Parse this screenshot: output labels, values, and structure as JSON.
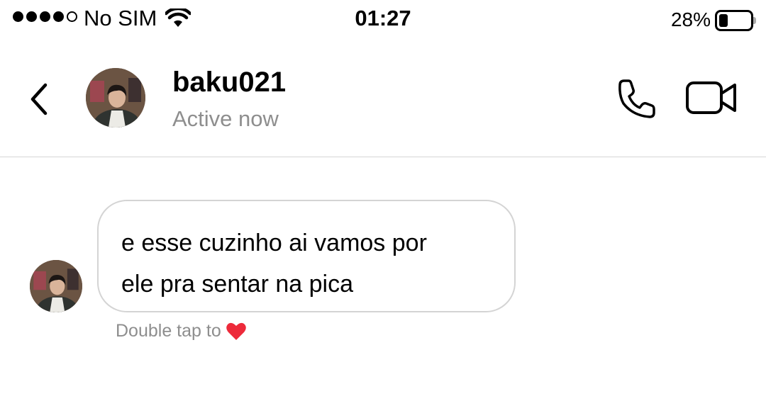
{
  "status_bar": {
    "carrier": "No SIM",
    "time": "01:27",
    "battery_percent": "28%",
    "battery_level": 0.28,
    "signal_bars_filled": 4,
    "signal_bars_total": 5
  },
  "header": {
    "username": "baku021",
    "activity": "Active now",
    "icons": [
      "chevron-left-icon",
      "phone-icon",
      "video-camera-icon"
    ]
  },
  "messages": [
    {
      "text_line_1": "e esse cuzinho ai vamos por",
      "text_line_2": "ele pra sentar na pica"
    }
  ],
  "hint": {
    "text": "Double tap to",
    "icon": "heart-icon",
    "icon_color": "#ed2a3a"
  },
  "colors": {
    "secondary_text": "#8e8e8e",
    "bubble_border": "#d4d4d4",
    "divider": "#d6d6d6"
  }
}
